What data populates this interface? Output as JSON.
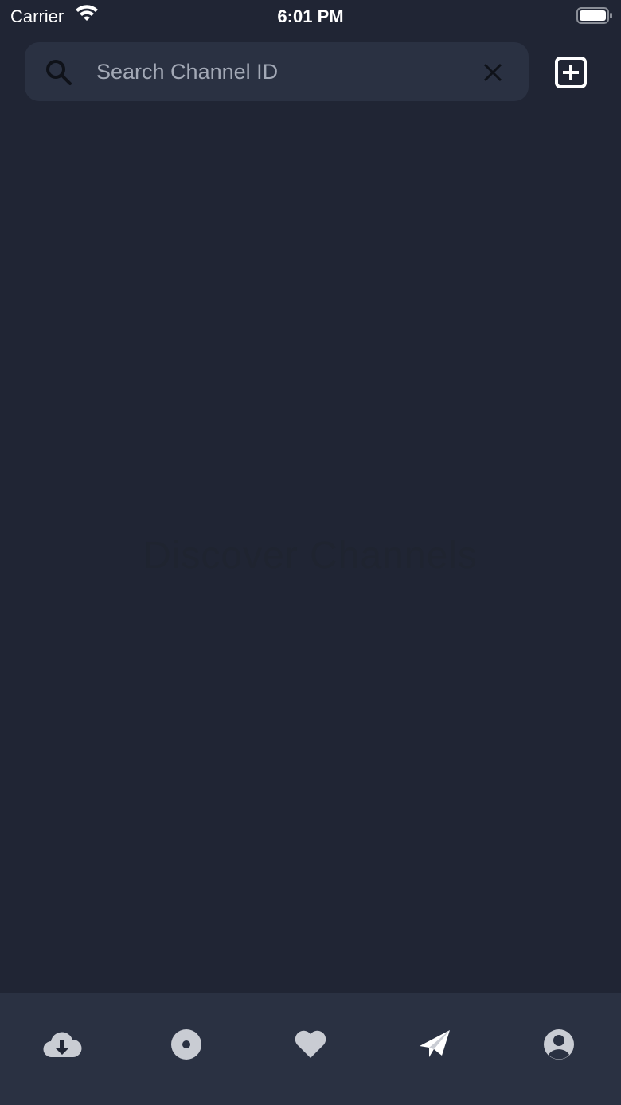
{
  "status_bar": {
    "carrier": "Carrier",
    "time": "6:01 PM"
  },
  "search": {
    "placeholder": "Search Channel ID",
    "value": ""
  },
  "empty_state": {
    "text": "Discover Channels"
  },
  "tabs": [
    {
      "icon": "cloud-download-icon",
      "active": false
    },
    {
      "icon": "record-icon",
      "active": false
    },
    {
      "icon": "heart-icon",
      "active": false
    },
    {
      "icon": "paper-plane-icon",
      "active": true
    },
    {
      "icon": "user-circle-icon",
      "active": false
    }
  ],
  "colors": {
    "background": "#202534",
    "surface": "#2a3142",
    "icon_inactive": "#c9ccd3",
    "icon_active": "#ffffff",
    "placeholder": "#a3a9b6"
  }
}
